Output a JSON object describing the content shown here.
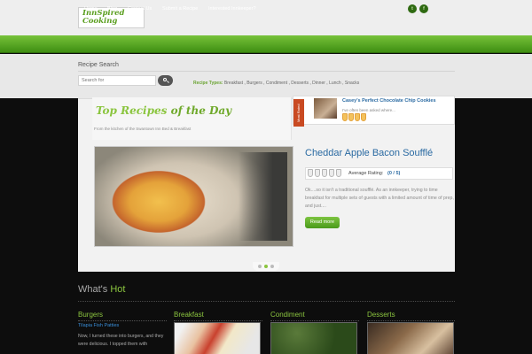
{
  "site": {
    "logo_line1": "InnSpired",
    "logo_line2": "Cooking"
  },
  "nav": {
    "items": [
      "Home",
      "Blog",
      "Contact Us",
      "Submit a Recipe",
      "Interested Innkeeper?"
    ],
    "social": [
      "t",
      "f"
    ]
  },
  "search": {
    "title": "Recipe Search",
    "placeholder": "Search for",
    "types_label": "Recipe Types:",
    "types": [
      "Breakfast",
      "Burgers",
      "Condiment",
      "Desserts",
      "Dinner",
      "Lunch",
      "Snacks"
    ]
  },
  "featured": {
    "heading_part1": "Top Recipes",
    "heading_part2": "of the Day",
    "subtitle": "From the kitchen of the Swantown Inn Bed & Breakfast",
    "most_rated_label": "Most Rated",
    "most_rated_title": "Casey's Perfect Chocolate Chip Cookies",
    "most_rated_excerpt": "I've often been asked where...",
    "recipe_title": "Cheddar Apple Bacon Soufflé",
    "rating_label": "Average Rating:",
    "rating_value": "(0 / 5)",
    "excerpt": "Ok....so it isn't a traditional soufflé. As an innkeeper, trying to time breakfast for multiple sets of guests with a limited amount of time of prep, and just....",
    "read_more": "Read more",
    "active_slide": 1
  },
  "hot": {
    "heading_what": "What's",
    "heading_hot": "Hot",
    "columns": [
      "Burgers",
      "Breakfast",
      "Condiment",
      "Desserts"
    ],
    "burgers_link": "Tilapia Fish Patties",
    "burgers_text": "Now, I turned these into burgers, and they were delicious. I topped them with"
  }
}
